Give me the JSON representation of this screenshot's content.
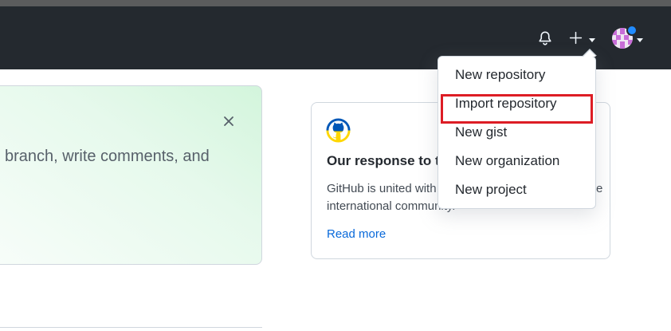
{
  "header": {
    "notifications": {
      "icon": "bell-icon"
    },
    "create": {
      "icon": "plus-icon",
      "caret_icon": "caret-down-icon"
    },
    "user": {
      "avatar_icon": "identicon-avatar",
      "status_dot": "blue-dot",
      "caret_icon": "caret-down-icon"
    }
  },
  "create_menu": {
    "items": [
      {
        "label": "New repository",
        "highlighted": false
      },
      {
        "label": "Import repository",
        "highlighted": true
      },
      {
        "label": "New gist",
        "highlighted": false
      },
      {
        "label": "New organization",
        "highlighted": false
      },
      {
        "label": "New project",
        "highlighted": false
      }
    ]
  },
  "welcome_banner": {
    "text": "branch, write comments, and",
    "close_icon": "close-icon"
  },
  "news_card": {
    "icon": "octocat-ukraine-icon",
    "title": "Our response to t",
    "body_line1": "GitHub is united with",
    "body_line1_tail": "e",
    "body_line2": "international community.",
    "link_label": "Read more"
  },
  "colors": {
    "header_bg": "#24292f",
    "link": "#0969da",
    "highlight_annotation": "#dd1d25",
    "status_dot": "#218bff",
    "ukraine_blue": "#0057b7",
    "ukraine_yellow": "#ffd700",
    "banner_green": "#d3f5dc"
  }
}
